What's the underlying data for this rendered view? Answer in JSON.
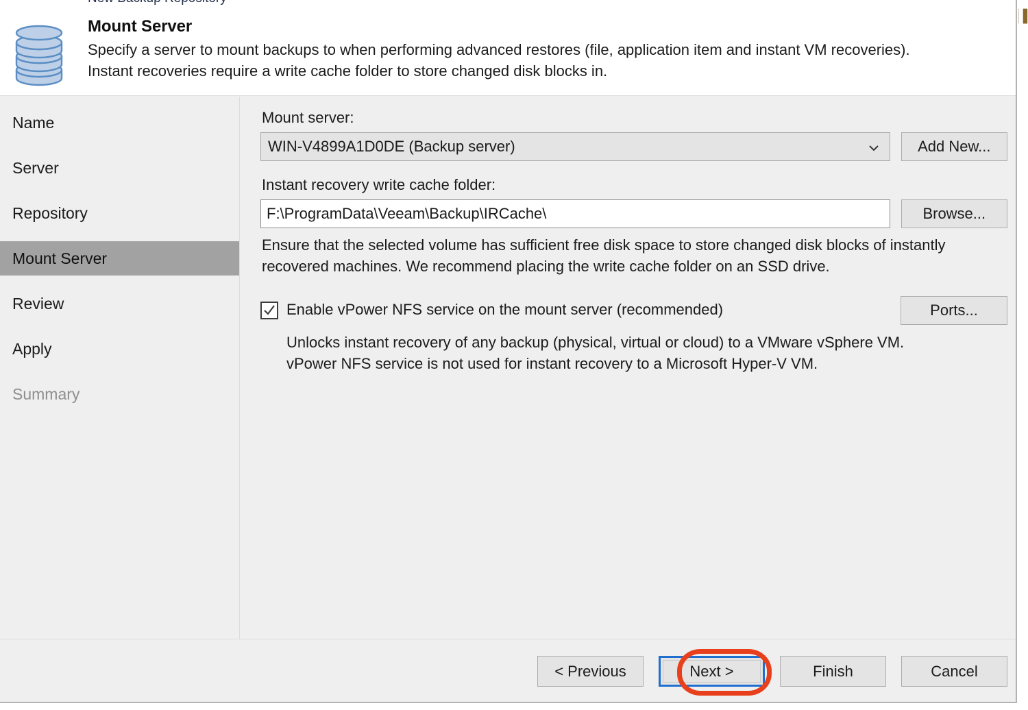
{
  "window": {
    "clipped_title_fragment": "New Backup Repository"
  },
  "header": {
    "icon": "database-stack-icon",
    "title": "Mount Server",
    "description_line1": "Specify a server to mount backups to when performing advanced restores (file, application item and instant VM recoveries).",
    "description_line2": "Instant recoveries require a write cache folder to store changed disk blocks in."
  },
  "sidebar": {
    "items": [
      {
        "label": "Name",
        "state": "normal"
      },
      {
        "label": "Server",
        "state": "normal"
      },
      {
        "label": "Repository",
        "state": "normal"
      },
      {
        "label": "Mount Server",
        "state": "active"
      },
      {
        "label": "Review",
        "state": "normal"
      },
      {
        "label": "Apply",
        "state": "normal"
      },
      {
        "label": "Summary",
        "state": "disabled"
      }
    ]
  },
  "main": {
    "mount_server": {
      "label": "Mount server:",
      "value": "WIN-V4899A1D0DE (Backup server)",
      "dropdown_icon": "chevron-down-icon",
      "add_new_button": "Add New..."
    },
    "cache_folder": {
      "label": "Instant recovery write cache folder:",
      "value": "F:\\ProgramData\\Veeam\\Backup\\IRCache\\",
      "browse_button": "Browse..."
    },
    "help_line1": "Ensure that the selected volume has sufficient free disk space to store changed disk blocks of instantly",
    "help_line2": "recovered machines. We recommend placing the write cache folder on an SSD drive.",
    "vpower": {
      "checkbox_label": "Enable vPower NFS service on the mount server (recommended)",
      "checked": true,
      "ports_button": "Ports...",
      "note_line1": "Unlocks instant recovery of any backup (physical, virtual or cloud) to a VMware vSphere VM.",
      "note_line2": "vPower NFS service is not used for instant recovery to a Microsoft Hyper-V VM."
    }
  },
  "footer": {
    "buttons": [
      {
        "label": "< Previous",
        "focused": false
      },
      {
        "label": "Next >",
        "focused": true
      },
      {
        "label": "Finish",
        "focused": false
      },
      {
        "label": "Cancel",
        "focused": false
      }
    ]
  },
  "annotation": {
    "shape": "red-ellipse-highlight",
    "target": "Next >",
    "color": "#e8401c"
  },
  "colors": {
    "dialog_bg": "#efefef",
    "header_bg": "#ffffff",
    "active_nav": "#a2a2a2",
    "focus_blue": "#1f6fd0",
    "annotation_red": "#e8401c",
    "icon_blue": "#bdd0e8",
    "icon_blue_stroke": "#5b8ec4"
  }
}
